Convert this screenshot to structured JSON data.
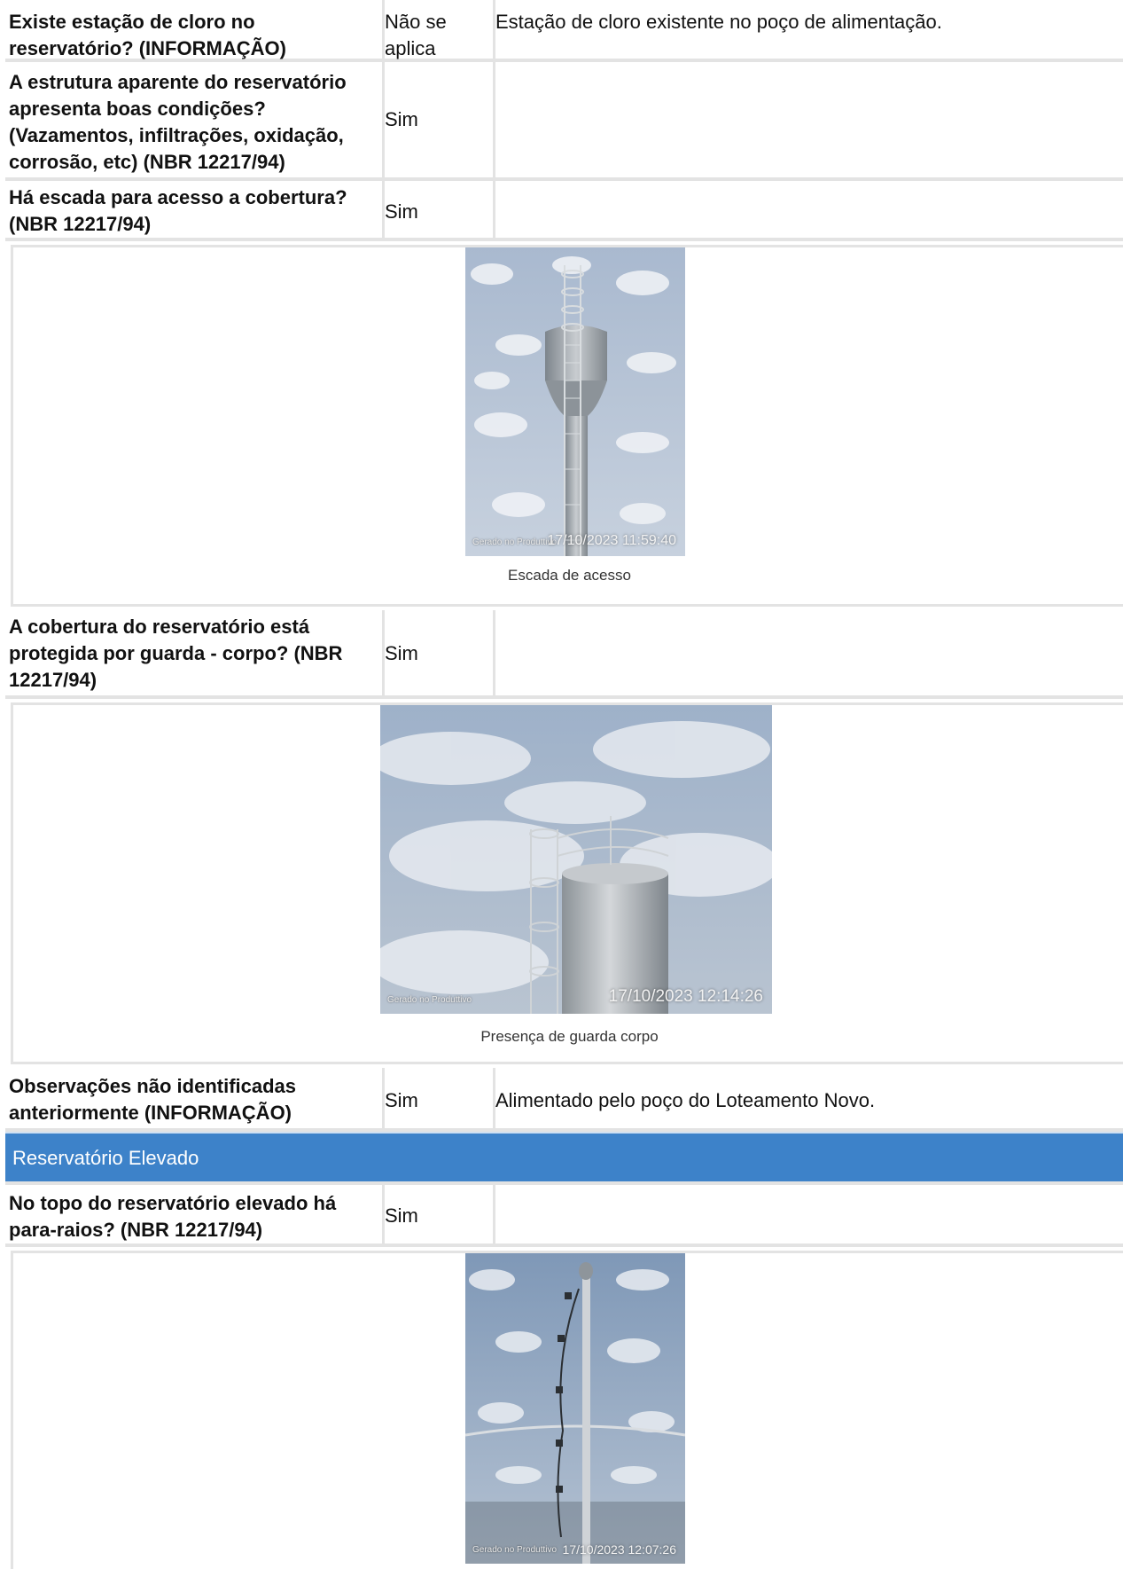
{
  "rows": [
    {
      "question": "Existe estação de cloro no reservatório? (INFORMAÇÃO)",
      "answer": "Não se aplica",
      "comment": "Estação de cloro existente no poço de alimentação."
    },
    {
      "question": "A estrutura aparente do reservatório apresenta boas condições? (Vazamentos, infiltrações, oxidação, corrosão, etc) (NBR 12217/94)",
      "answer": "Sim",
      "comment": ""
    },
    {
      "question": "Há escada para acesso a cobertura? (NBR 12217/94)",
      "answer": "Sim",
      "comment": ""
    },
    {
      "question": "A cobertura do reservatório está protegida por guarda - corpo? (NBR 12217/94)",
      "answer": "Sim",
      "comment": ""
    },
    {
      "question": "Observações não identificadas anteriormente (INFORMAÇÃO)",
      "answer": "Sim",
      "comment": "Alimentado pelo poço do Loteamento Novo."
    },
    {
      "question": "No topo do reservatório elevado há para-raios? (NBR 12217/94)",
      "answer": "Sim",
      "comment": ""
    }
  ],
  "photos": [
    {
      "caption": "Escada de acesso",
      "timestamp": "17/10/2023 11:59:40",
      "brand": "Gerado no Produttivo"
    },
    {
      "caption": "Presença de guarda corpo",
      "timestamp": "17/10/2023 12:14:26",
      "brand": "Gerado no Produttivo"
    },
    {
      "caption": "",
      "timestamp": "17/10/2023 12:07:26",
      "brand": "Gerado no Produttivo"
    }
  ],
  "section": {
    "title": "Reservatório Elevado"
  }
}
